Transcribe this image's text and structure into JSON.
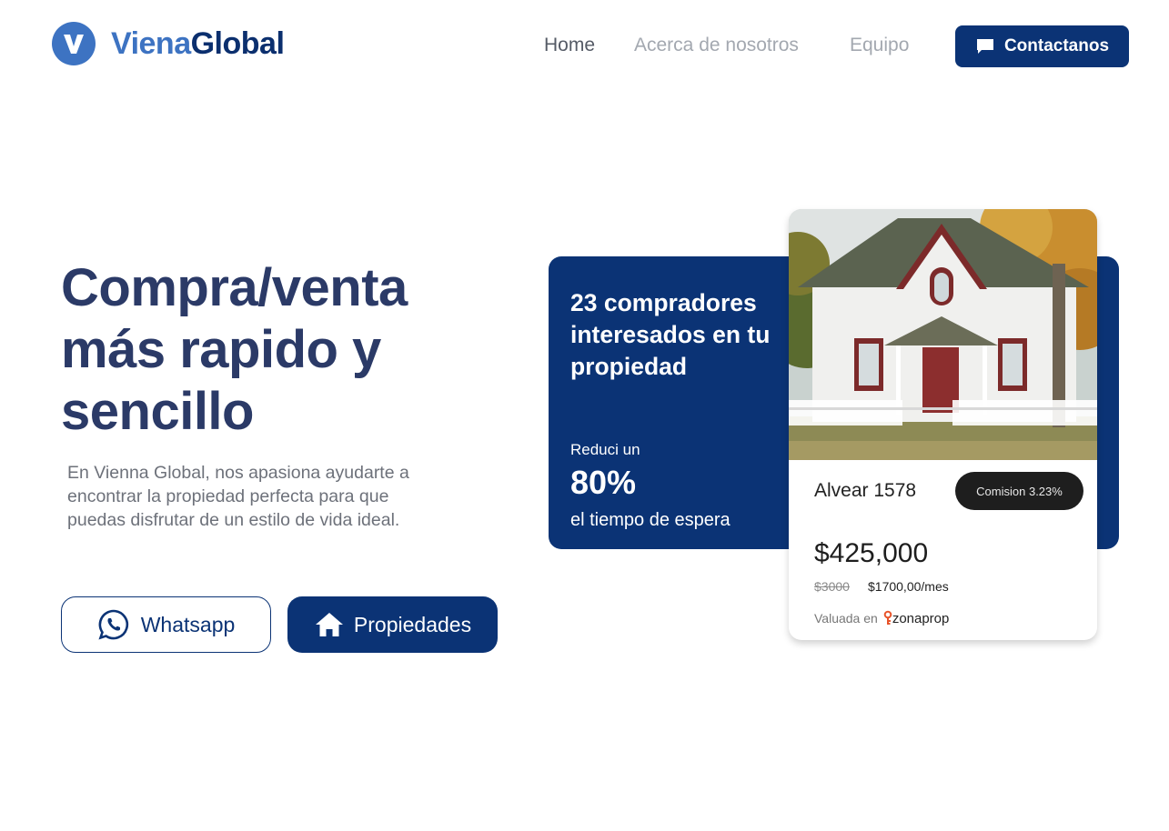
{
  "brand": {
    "name_part1": "Viena",
    "name_part2": "Global",
    "primary": "#0b3375",
    "accent": "#3d73c2"
  },
  "nav": {
    "home": "Home",
    "about": "Acerca de nosotros",
    "team": "Equipo",
    "contact": "Contactanos"
  },
  "hero": {
    "title": "Compra/venta más rapido y sencillo",
    "description": "En Vienna Global, nos apasiona ayudarte a encontrar la propiedad perfecta para que puedas disfrutar de un estilo de vida ideal.",
    "whatsapp_label": "Whatsapp",
    "properties_label": "Propiedades"
  },
  "stats": {
    "headline": "23 compradores interesados en tu propiedad",
    "reduce": "Reduci un",
    "percent": "80%",
    "wait": "el tiempo de espera"
  },
  "property": {
    "address": "Alvear 1578",
    "commission": "Comision 3.23%",
    "price": "$425,000",
    "old_price": "$3000",
    "rent": "$1700,00/mes",
    "valued_label": "Valuada en",
    "valued_brand": "zonaprop"
  },
  "icons": {
    "logo": "v-logo-icon",
    "contact": "chat-bubble-icon",
    "whatsapp": "whatsapp-icon",
    "properties": "home-icon",
    "zonaprop": "key-icon"
  }
}
